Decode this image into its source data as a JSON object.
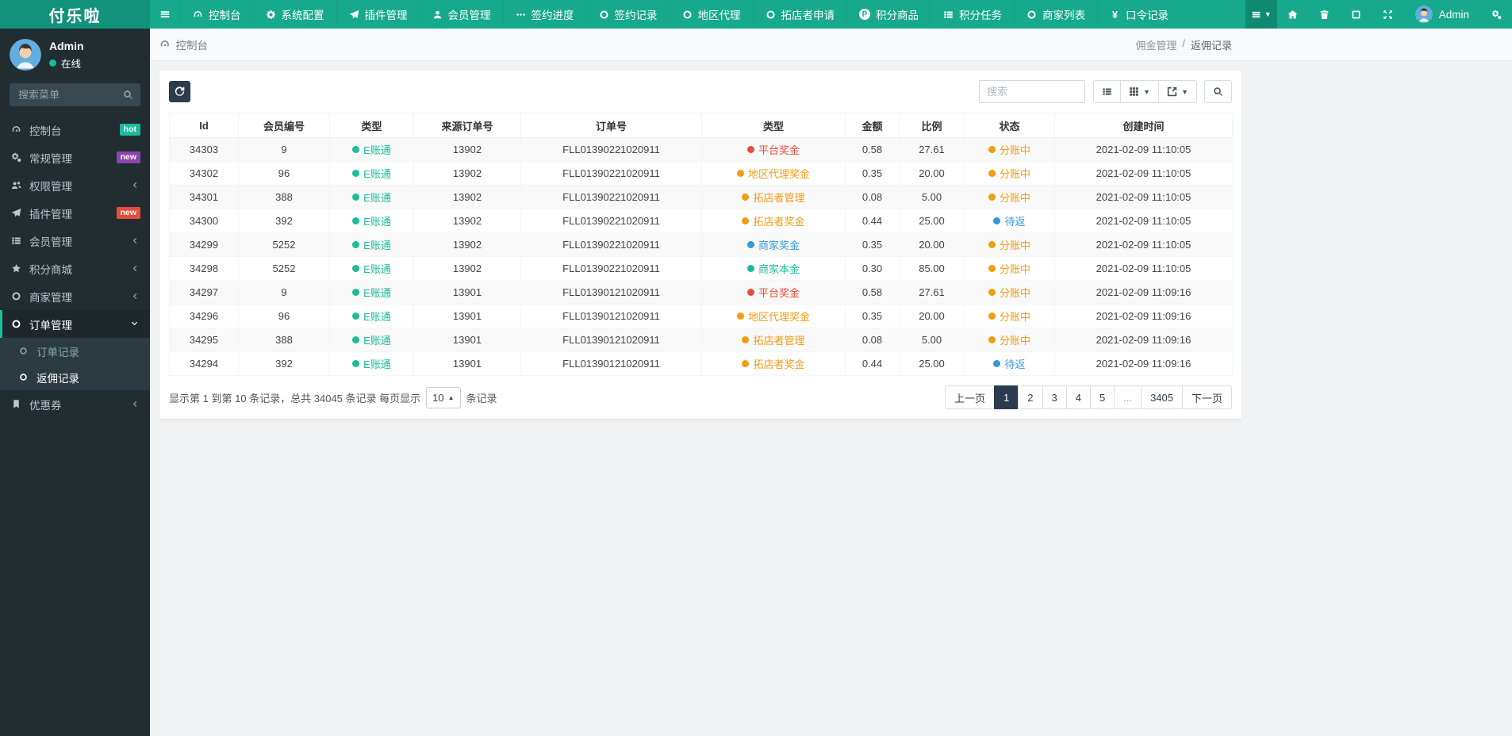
{
  "brand": "付乐啦",
  "colors": {
    "navbar": "#17a98b",
    "brand_bg": "#12927b",
    "sidebar_bg": "#222d32",
    "submenu_bg": "#2c3b41",
    "teal": "#1abc9c",
    "dark": "#2c3b4e",
    "red": "#e74c3c",
    "orange": "#f39c12",
    "blue": "#3498db",
    "purple": "#8e44ad",
    "stripe": "#f9f9f9"
  },
  "topnav": {
    "items": [
      {
        "label": "控制台",
        "icon": "dashboard"
      },
      {
        "label": "系统配置",
        "icon": "gear"
      },
      {
        "label": "插件管理",
        "icon": "paper-plane"
      },
      {
        "label": "会员管理",
        "icon": "user"
      },
      {
        "label": "签约进度",
        "icon": "ellipsis"
      },
      {
        "label": "签约记录",
        "icon": "circle"
      },
      {
        "label": "地区代理",
        "icon": "circle"
      },
      {
        "label": "拓店者申请",
        "icon": "circle"
      },
      {
        "label": "积分商品",
        "icon": "p-circle"
      },
      {
        "label": "积分任务",
        "icon": "th-list"
      },
      {
        "label": "商家列表",
        "icon": "circle"
      },
      {
        "label": "口令记录",
        "icon": "yen"
      }
    ],
    "right_icons": [
      {
        "name": "menu-dropdown",
        "icon": "bars",
        "caret": true,
        "active": true
      },
      {
        "name": "home",
        "icon": "home"
      },
      {
        "name": "clear-cache",
        "icon": "trash"
      },
      {
        "name": "module-market",
        "icon": "apps"
      },
      {
        "name": "fullscreen",
        "icon": "expand"
      }
    ],
    "user_name": "Admin",
    "settings_icon": "cogs"
  },
  "sidebar": {
    "user": {
      "name": "Admin",
      "status": "在线"
    },
    "search_placeholder": "搜索菜单",
    "items": [
      {
        "label": "控制台",
        "icon": "dashboard",
        "badge": {
          "text": "hot",
          "color": "teal"
        }
      },
      {
        "label": "常规管理",
        "icon": "cogs",
        "badge": {
          "text": "new",
          "color": "purple"
        }
      },
      {
        "label": "权限管理",
        "icon": "users",
        "chevron": "left"
      },
      {
        "label": "插件管理",
        "icon": "paper-plane",
        "badge": {
          "text": "new",
          "color": "red"
        }
      },
      {
        "label": "会员管理",
        "icon": "th-list",
        "chevron": "left"
      },
      {
        "label": "积分商城",
        "icon": "star",
        "chevron": "left"
      },
      {
        "label": "商家管理",
        "icon": "circle",
        "chevron": "left"
      },
      {
        "label": "订单管理",
        "icon": "circle",
        "chevron": "down",
        "active": true,
        "children": [
          {
            "label": "订单记录",
            "icon": "circle",
            "active": false
          },
          {
            "label": "返佣记录",
            "icon": "circle",
            "active": true
          }
        ]
      },
      {
        "label": "优惠券",
        "icon": "bookmark",
        "chevron": "left"
      }
    ]
  },
  "breadcrumb": {
    "left_icon": "dashboard",
    "left": "控制台",
    "right_parent": "佣金管理",
    "right_separator": "/",
    "right_current": "返佣记录"
  },
  "toolbar": {
    "refresh_icon": "refresh",
    "search_placeholder": "搜索",
    "buttons": [
      {
        "name": "toggle-view",
        "icon": "th-list",
        "caret": false
      },
      {
        "name": "columns",
        "icon": "th",
        "caret": true
      },
      {
        "name": "export",
        "icon": "export",
        "caret": true
      }
    ],
    "search_button_icon": "search"
  },
  "table": {
    "columns": [
      "Id",
      "会员编号",
      "类型",
      "来源订单号",
      "订单号",
      "类型",
      "金额",
      "比例",
      "状态",
      "创建时间"
    ],
    "rows": [
      {
        "id": "34303",
        "member": "9",
        "account": {
          "t": "E账通",
          "c": "teal"
        },
        "source": "13902",
        "order": "FLL01390221020911",
        "type": {
          "t": "平台奖金",
          "c": "red"
        },
        "amount": "0.58",
        "ratio": "27.61",
        "status": {
          "t": "分账中",
          "c": "orange"
        },
        "created": "2021-02-09 11:10:05"
      },
      {
        "id": "34302",
        "member": "96",
        "account": {
          "t": "E账通",
          "c": "teal"
        },
        "source": "13902",
        "order": "FLL01390221020911",
        "type": {
          "t": "地区代理奖金",
          "c": "orange"
        },
        "amount": "0.35",
        "ratio": "20.00",
        "status": {
          "t": "分账中",
          "c": "orange"
        },
        "created": "2021-02-09 11:10:05"
      },
      {
        "id": "34301",
        "member": "388",
        "account": {
          "t": "E账通",
          "c": "teal"
        },
        "source": "13902",
        "order": "FLL01390221020911",
        "type": {
          "t": "拓店者管理",
          "c": "orange"
        },
        "amount": "0.08",
        "ratio": "5.00",
        "status": {
          "t": "分账中",
          "c": "orange"
        },
        "created": "2021-02-09 11:10:05"
      },
      {
        "id": "34300",
        "member": "392",
        "account": {
          "t": "E账通",
          "c": "teal"
        },
        "source": "13902",
        "order": "FLL01390221020911",
        "type": {
          "t": "拓店者奖金",
          "c": "orange"
        },
        "amount": "0.44",
        "ratio": "25.00",
        "status": {
          "t": "待返",
          "c": "blue"
        },
        "created": "2021-02-09 11:10:05"
      },
      {
        "id": "34299",
        "member": "5252",
        "account": {
          "t": "E账通",
          "c": "teal"
        },
        "source": "13902",
        "order": "FLL01390221020911",
        "type": {
          "t": "商家奖金",
          "c": "blue"
        },
        "amount": "0.35",
        "ratio": "20.00",
        "status": {
          "t": "分账中",
          "c": "orange"
        },
        "created": "2021-02-09 11:10:05"
      },
      {
        "id": "34298",
        "member": "5252",
        "account": {
          "t": "E账通",
          "c": "teal"
        },
        "source": "13902",
        "order": "FLL01390221020911",
        "type": {
          "t": "商家本金",
          "c": "teal"
        },
        "amount": "0.30",
        "ratio": "85.00",
        "status": {
          "t": "分账中",
          "c": "orange"
        },
        "created": "2021-02-09 11:10:05"
      },
      {
        "id": "34297",
        "member": "9",
        "account": {
          "t": "E账通",
          "c": "teal"
        },
        "source": "13901",
        "order": "FLL01390121020911",
        "type": {
          "t": "平台奖金",
          "c": "red"
        },
        "amount": "0.58",
        "ratio": "27.61",
        "status": {
          "t": "分账中",
          "c": "orange"
        },
        "created": "2021-02-09 11:09:16"
      },
      {
        "id": "34296",
        "member": "96",
        "account": {
          "t": "E账通",
          "c": "teal"
        },
        "source": "13901",
        "order": "FLL01390121020911",
        "type": {
          "t": "地区代理奖金",
          "c": "orange"
        },
        "amount": "0.35",
        "ratio": "20.00",
        "status": {
          "t": "分账中",
          "c": "orange"
        },
        "created": "2021-02-09 11:09:16"
      },
      {
        "id": "34295",
        "member": "388",
        "account": {
          "t": "E账通",
          "c": "teal"
        },
        "source": "13901",
        "order": "FLL01390121020911",
        "type": {
          "t": "拓店者管理",
          "c": "orange"
        },
        "amount": "0.08",
        "ratio": "5.00",
        "status": {
          "t": "分账中",
          "c": "orange"
        },
        "created": "2021-02-09 11:09:16"
      },
      {
        "id": "34294",
        "member": "392",
        "account": {
          "t": "E账通",
          "c": "teal"
        },
        "source": "13901",
        "order": "FLL01390121020911",
        "type": {
          "t": "拓店者奖金",
          "c": "orange"
        },
        "amount": "0.44",
        "ratio": "25.00",
        "status": {
          "t": "待返",
          "c": "blue"
        },
        "created": "2021-02-09 11:09:16"
      }
    ]
  },
  "pagination": {
    "info_prefix": "显示第 1 到第 10 条记录，总共 34045 条记录 每页显示",
    "page_size": "10",
    "info_suffix": "条记录",
    "pages": [
      "上一页",
      "1",
      "2",
      "3",
      "4",
      "5",
      "...",
      "3405",
      "下一页"
    ],
    "active_page": "1"
  }
}
